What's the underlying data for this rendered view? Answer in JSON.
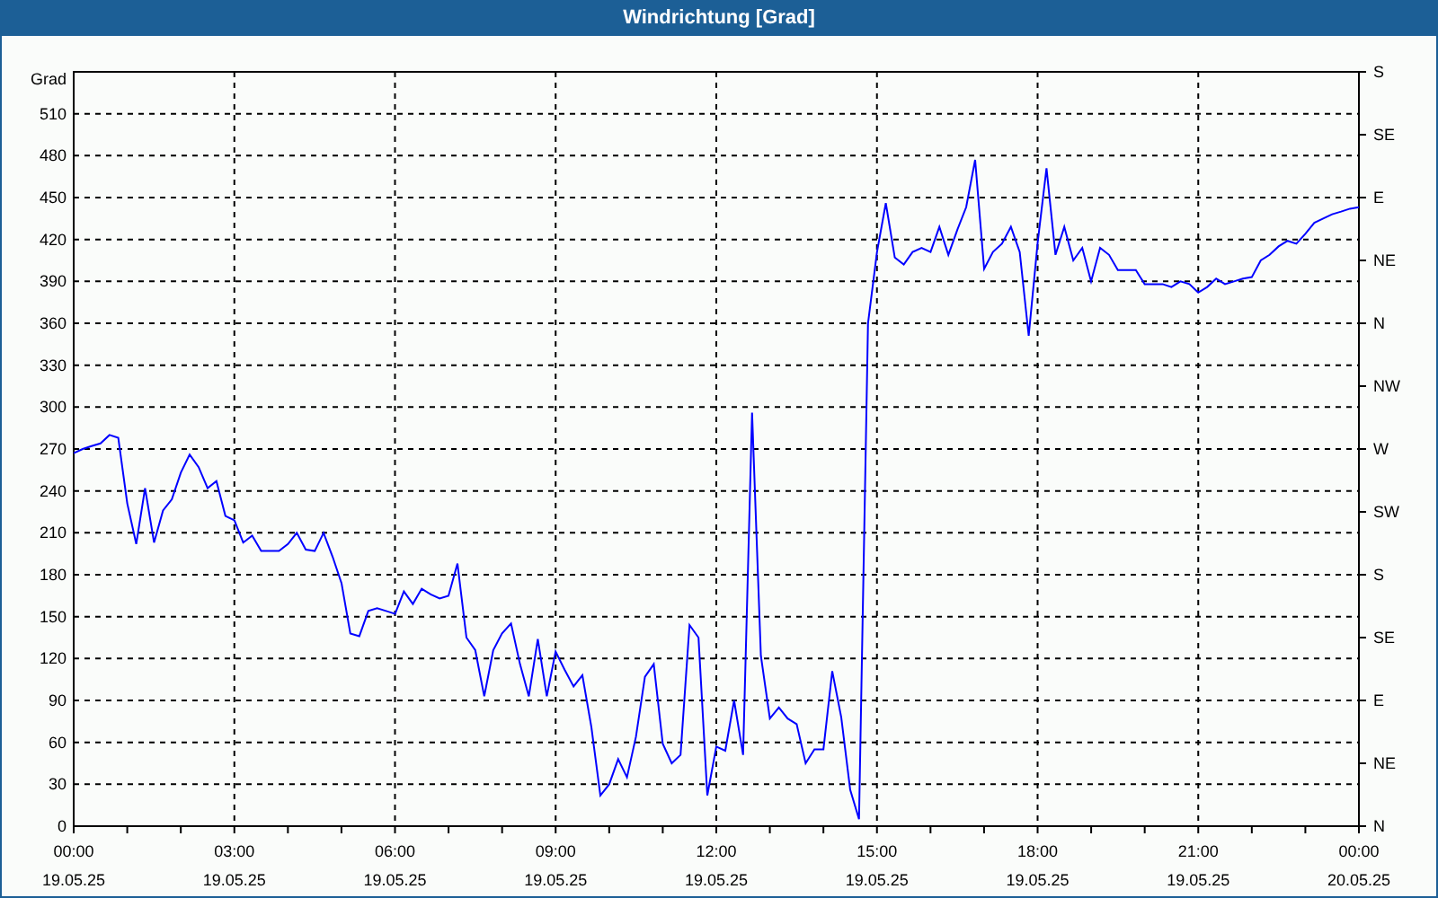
{
  "window": {
    "title": "Windrichtung [Grad]"
  },
  "chart": {
    "right_axis_labels": [
      "S",
      "SE",
      "E",
      "NE",
      "N",
      "NW",
      "W",
      "SW",
      "S",
      "SE",
      "E",
      "NE",
      "N"
    ],
    "chart_data": {
      "type": "line",
      "grid": true,
      "ylabel": "Grad",
      "ylim": [
        0,
        540
      ],
      "yticks": [
        0,
        30,
        60,
        90,
        120,
        150,
        180,
        210,
        240,
        270,
        300,
        330,
        360,
        390,
        420,
        450,
        480,
        510
      ],
      "categories": [
        "00:00\n19.05.25",
        null,
        null,
        null,
        null,
        null,
        null,
        null,
        null,
        null,
        null,
        null,
        null,
        null,
        null,
        null,
        null,
        null,
        "03:00\n19.05.25",
        null,
        null,
        null,
        null,
        null,
        null,
        null,
        null,
        null,
        null,
        null,
        null,
        null,
        null,
        null,
        null,
        null,
        "06:00\n19.05.25",
        null,
        null,
        null,
        null,
        null,
        null,
        null,
        null,
        null,
        null,
        null,
        null,
        null,
        null,
        null,
        null,
        null,
        "09:00\n19.05.25",
        null,
        null,
        null,
        null,
        null,
        null,
        null,
        null,
        null,
        null,
        null,
        null,
        null,
        null,
        null,
        null,
        null,
        "12:00\n19.05.25",
        null,
        null,
        null,
        null,
        null,
        null,
        null,
        null,
        null,
        null,
        null,
        null,
        null,
        null,
        null,
        null,
        null,
        "15:00\n19.05.25",
        null,
        null,
        null,
        null,
        null,
        null,
        null,
        null,
        null,
        null,
        null,
        null,
        null,
        null,
        null,
        null,
        null,
        "18:00\n19.05.25",
        null,
        null,
        null,
        null,
        null,
        null,
        null,
        null,
        null,
        null,
        null,
        null,
        null,
        null,
        null,
        null,
        null,
        "21:00\n19.05.25",
        null,
        null,
        null,
        null,
        null,
        null,
        null,
        null,
        null,
        null,
        null,
        null,
        null,
        null,
        null,
        null,
        null,
        "00:00\n20.05.25"
      ],
      "series": [
        {
          "color": "#0000ff",
          "values": [
            267,
            270,
            272,
            274,
            280,
            278,
            231,
            202,
            242,
            203,
            226,
            234,
            253,
            266,
            257,
            242,
            247,
            222,
            219,
            203,
            208,
            197,
            197,
            197,
            202,
            210,
            198,
            197,
            210,
            193,
            174,
            138,
            136,
            154,
            156,
            154,
            152,
            168,
            159,
            170,
            166,
            163,
            165,
            188,
            135,
            126,
            93,
            126,
            138,
            145,
            116,
            93,
            134,
            93,
            125,
            112,
            100,
            108,
            71,
            22,
            30,
            48,
            35,
            64,
            107,
            116,
            59,
            45,
            51,
            144,
            135,
            22,
            57,
            54,
            90,
            51,
            296,
            122,
            77,
            85,
            77,
            73,
            45,
            55,
            55,
            111,
            78,
            26,
            5,
            360,
            411,
            446,
            407,
            402,
            411,
            414,
            411,
            429,
            409,
            427,
            443,
            477,
            399,
            411,
            417,
            429,
            411,
            351,
            418,
            471,
            409,
            429,
            405,
            414,
            390,
            414,
            409,
            398,
            398,
            398,
            388,
            388,
            388,
            386,
            390,
            388,
            382,
            386,
            392,
            388,
            390,
            392,
            393,
            405,
            409,
            415,
            419,
            417,
            424,
            432,
            435,
            438,
            440,
            442,
            443
          ]
        }
      ]
    }
  }
}
